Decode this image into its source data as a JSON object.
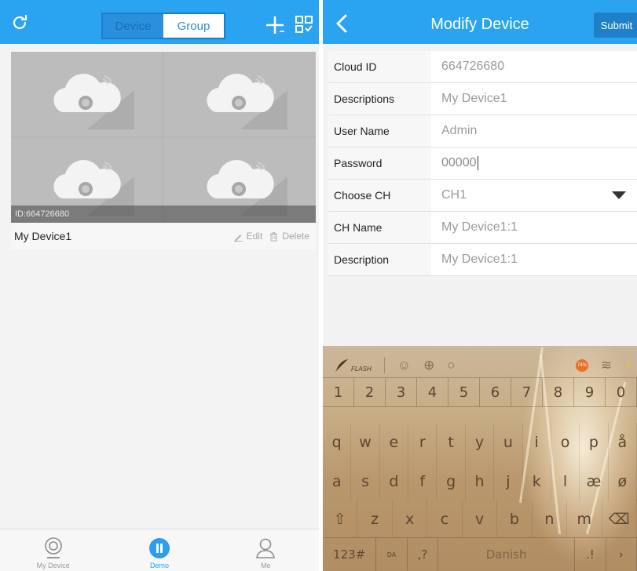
{
  "left": {
    "tabs": {
      "device": "Device",
      "group": "Group"
    },
    "card": {
      "id_label": "ID:664726680",
      "device_name": "My Device1",
      "edit_label": "Edit",
      "delete_label": "Delete"
    },
    "tabbar": [
      {
        "label": "My Device",
        "icon": "camera-icon"
      },
      {
        "label": "Demo",
        "icon": "play-pause-icon"
      },
      {
        "label": "Me",
        "icon": "person-icon"
      }
    ]
  },
  "right": {
    "title": "Modify Device",
    "submit_label": "Submit",
    "fields": [
      {
        "label": "Cloud ID",
        "value": "664726680"
      },
      {
        "label": "Descriptions",
        "value": "My Device1"
      },
      {
        "label": "User Name",
        "value": "Admin"
      },
      {
        "label": "Password",
        "value": "00000"
      },
      {
        "label": "Choose CH",
        "value": "CH1"
      },
      {
        "label": "CH Name",
        "value": "My Device1:1"
      },
      {
        "label": "Description",
        "value": "My Device1:1"
      }
    ]
  },
  "keyboard": {
    "toolbar_flash": "FLASH",
    "battery": "74%",
    "numbers": [
      "1",
      "2",
      "3",
      "4",
      "5",
      "6",
      "7",
      "8",
      "9",
      "0"
    ],
    "row1": [
      "q",
      "w",
      "e",
      "r",
      "t",
      "y",
      "u",
      "i",
      "o",
      "p",
      "å"
    ],
    "row2": [
      "a",
      "s",
      "d",
      "f",
      "g",
      "h",
      "j",
      "k",
      "l",
      "æ",
      "ø"
    ],
    "row3": [
      "⇧",
      "z",
      "x",
      "c",
      "v",
      "b",
      "n",
      "m",
      "⌫"
    ],
    "mode_key": "123#",
    "lang_hint": "DA",
    "comma_key": ",?",
    "space_label": "Danish",
    "period_key": ".!",
    "next_key": "›"
  },
  "colors": {
    "brand_blue": "#2aa3f0",
    "submit_blue": "#1f7fc9"
  }
}
